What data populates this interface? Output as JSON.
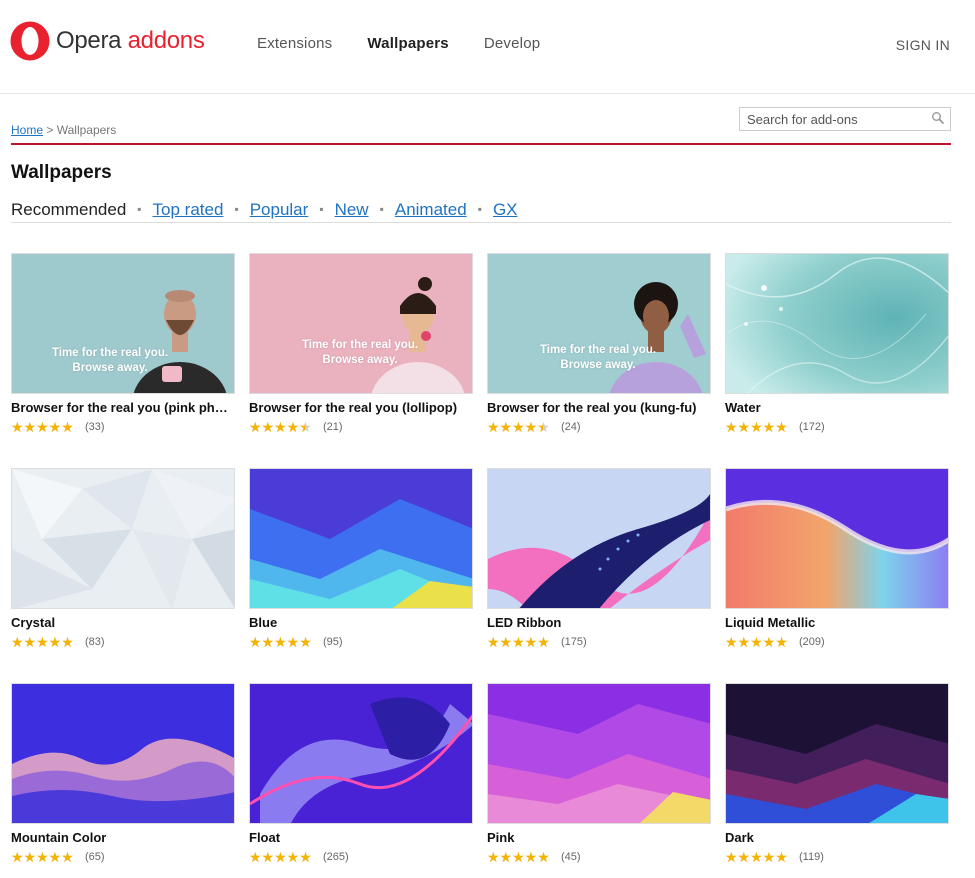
{
  "header": {
    "logo_main": "Opera",
    "logo_accent": "addons",
    "nav": [
      {
        "label": "Extensions",
        "active": false
      },
      {
        "label": "Wallpapers",
        "active": true
      },
      {
        "label": "Develop",
        "active": false
      }
    ],
    "signin_label": "SIGN IN"
  },
  "breadcrumb": {
    "home": "Home",
    "separator": ">",
    "current": "Wallpapers"
  },
  "search": {
    "placeholder": "Search for add-ons",
    "icon": "magnifier-icon"
  },
  "page_title": "Wallpapers",
  "tabs": [
    {
      "label": "Recommended",
      "current": true
    },
    {
      "label": "Top rated",
      "current": false
    },
    {
      "label": "Popular",
      "current": false
    },
    {
      "label": "New",
      "current": false
    },
    {
      "label": "Animated",
      "current": false
    },
    {
      "label": "GX",
      "current": false
    }
  ],
  "overlay_text": {
    "line1": "Time for the real you.",
    "line2": "Browse away."
  },
  "colors": {
    "brand_red": "#e8222f",
    "rule_red": "#c2112c",
    "link_blue": "#1f73c1",
    "star_gold": "#f4b400"
  },
  "wallpapers": [
    {
      "title": "Browser for the real you (pink ph…",
      "rating": 4.5,
      "count": "(33)",
      "theme": "man"
    },
    {
      "title": "Browser for the real you (lollipop)",
      "rating": 4.0,
      "count": "(21)",
      "theme": "lollipop"
    },
    {
      "title": "Browser for the real you (kung-fu)",
      "rating": 4.0,
      "count": "(24)",
      "theme": "kungfu"
    },
    {
      "title": "Water",
      "rating": 4.5,
      "count": "(172)",
      "theme": "water"
    },
    {
      "title": "Crystal",
      "rating": 4.5,
      "count": "(83)",
      "theme": "crystal"
    },
    {
      "title": "Blue",
      "rating": 4.5,
      "count": "(95)",
      "theme": "blue"
    },
    {
      "title": "LED Ribbon",
      "rating": 4.5,
      "count": "(175)",
      "theme": "led"
    },
    {
      "title": "Liquid Metallic",
      "rating": 4.5,
      "count": "(209)",
      "theme": "liquid"
    },
    {
      "title": "Mountain Color",
      "rating": 4.5,
      "count": "(65)",
      "theme": "mountain"
    },
    {
      "title": "Float",
      "rating": 4.5,
      "count": "(265)",
      "theme": "float"
    },
    {
      "title": "Pink",
      "rating": 4.5,
      "count": "(45)",
      "theme": "pink"
    },
    {
      "title": "Dark",
      "rating": 4.5,
      "count": "(119)",
      "theme": "dark"
    }
  ]
}
